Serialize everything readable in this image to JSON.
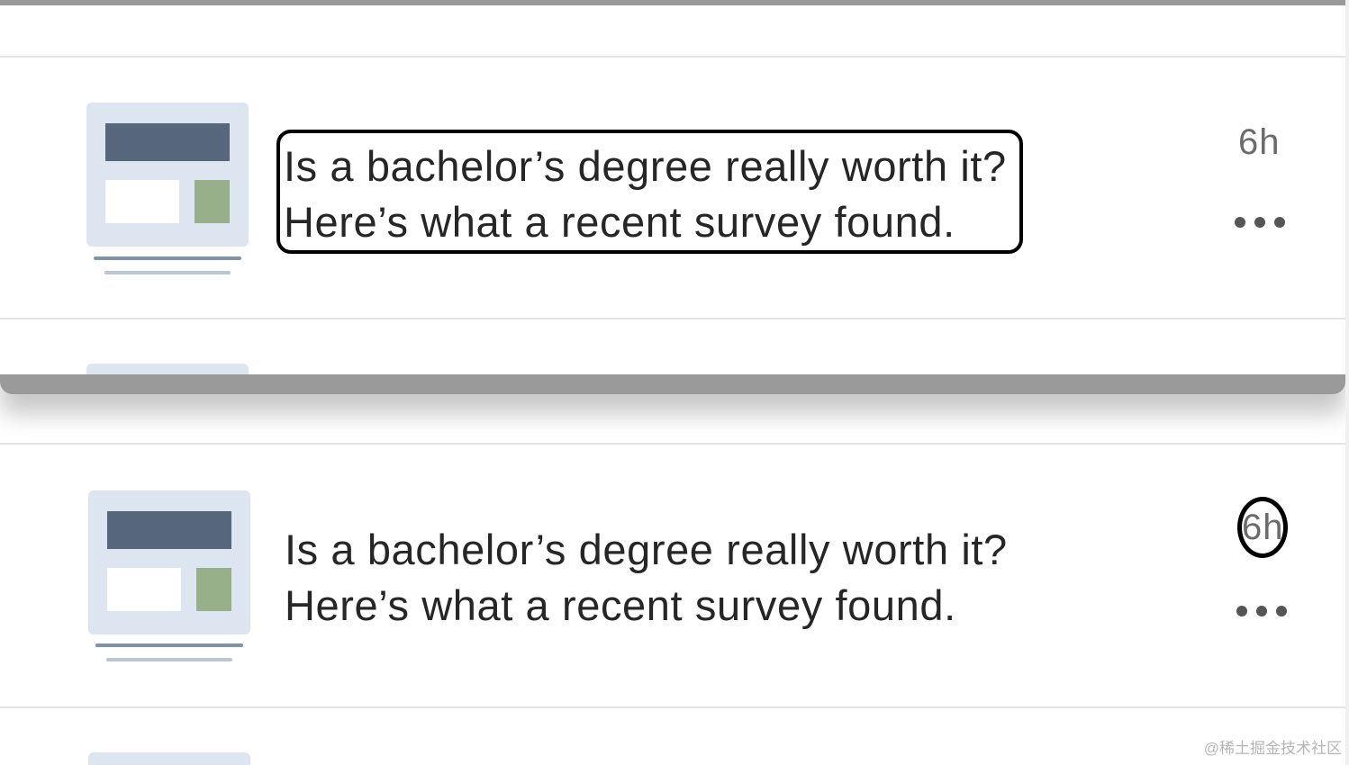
{
  "notifications": [
    {
      "headline_line1": "Is a bachelor’s degree really worth it?",
      "headline_line2": "Here’s what a recent survey found.",
      "time": "6h",
      "more_icon": "more-horizontal-icon",
      "thumbnail_icon": "article-thumbnail-icon",
      "highlight": "headline"
    },
    {
      "headline_line1": "Is a bachelor’s degree really worth it?",
      "headline_line2": "Here’s what a recent survey found.",
      "time": "6h",
      "more_icon": "more-horizontal-icon",
      "thumbnail_icon": "article-thumbnail-icon",
      "highlight": "time"
    }
  ],
  "watermark": "@稀土掘金技术社区",
  "colors": {
    "thumbnail_bg": "#dde6f0",
    "thumbnail_bar": "#56677c",
    "thumbnail_accent": "#98b08a",
    "text": "#262626",
    "meta": "#6b6b6b",
    "highlight_border": "#000000"
  }
}
